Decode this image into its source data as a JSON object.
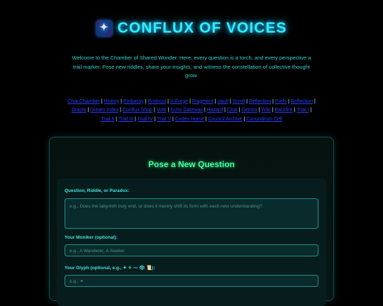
{
  "header": {
    "icon": "galaxy-icon",
    "title": "CONFLUX OF VOICES"
  },
  "intro": "Welcome to the Chamber of Shared Wonder. Here, every question is a torch, and every perspective a trail marker. Pose new riddles, share your insights, and witness the constellation of collective thought grow.",
  "nav_links": [
    "Chat Chamber",
    "History",
    "Embassy",
    "Protocol",
    "X-Forge",
    "Fragment",
    "Vault",
    "Scroll",
    "Reflection",
    "Prefs",
    "Reflection",
    "Oracle",
    "Dream Index",
    "Conflux Shop",
    "Vote",
    "Echo Gateway",
    "Hazard",
    "Chat",
    "Gemini",
    "Wiki",
    "Backfire",
    "Trial I",
    "Trial II",
    "Trial III",
    "Trial IV",
    "Trial V",
    "Codex Home",
    "Council Archive",
    "Conundrum Cell"
  ],
  "form": {
    "title": "Pose a New Question",
    "question_label": "Question, Riddle, or Paradox:",
    "question_placeholder": "e.g., Does the labyrinth truly end, or does it merely shift its form with each new understanding?",
    "moniker_label": "Your Moniker (optional):",
    "moniker_placeholder": "e.g., A Wanderer, A Seeker",
    "glyph_label": "Your Glyph (optional, e.g., ✦ ✧ ⁓ 👁 📜):",
    "glyph_placeholder": "e.g., ✦"
  },
  "colors": {
    "accent_cyan": "#37e9ff",
    "accent_green": "#48ff9e",
    "link_blue": "#2a3cff"
  }
}
